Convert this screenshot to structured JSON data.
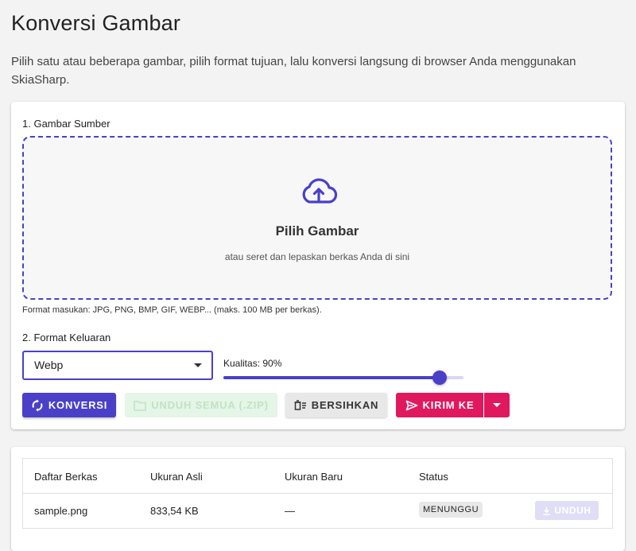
{
  "page": {
    "title": "Konversi Gambar",
    "description": "Pilih satu atau beberapa gambar, pilih format tujuan, lalu konversi langsung di browser Anda menggunakan SkiaSharp."
  },
  "source": {
    "section_label": "1. Gambar Sumber",
    "dropzone_title": "Pilih Gambar",
    "dropzone_subtitle": "atau seret dan lepaskan berkas Anda di sini",
    "input_hint": "Format masukan: JPG, PNG, BMP, GIF, WEBP... (maks. 100 MB per berkas)."
  },
  "output": {
    "section_label": "2. Format Keluaran",
    "format_value": "Webp",
    "quality_label": "Kualitas: 90%",
    "quality_value": 90
  },
  "actions": {
    "convert": "KONVERSI",
    "download_all": "UNDUH SEMUA (.ZIP)",
    "clear": "BERSIHKAN",
    "send_to": "KIRIM KE"
  },
  "files_table": {
    "headers": [
      "Daftar Berkas",
      "Ukuran Asli",
      "Ukuran Baru",
      "Status"
    ],
    "rows": [
      {
        "name": "sample.png",
        "original_size": "833,54 KB",
        "new_size": "—",
        "status": "MENUNGGU",
        "download_label": "UNDUH"
      }
    ]
  },
  "colors": {
    "primary": "#4a40c8",
    "accent": "#e0195e",
    "background": "#f3f3f3"
  },
  "icons": {
    "dropzone": "cloud-upload-icon",
    "convert": "sync-icon",
    "download_all": "folder-icon",
    "clear": "clear-all-icon",
    "send_to": "send-icon",
    "row_download": "download-icon"
  }
}
